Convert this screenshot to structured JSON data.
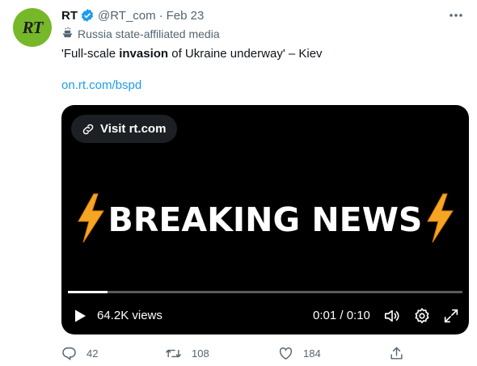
{
  "tweet": {
    "avatar_text": "RT",
    "author_name": "RT",
    "handle": "@RT_com",
    "separator": "·",
    "date": "Feb 23",
    "label": "Russia state-affiliated media",
    "text_before": "'Full-scale ",
    "text_bold": "invasion",
    "text_after": " of Ukraine underway' – Kiev",
    "link": "on.rt.com/bspd"
  },
  "media": {
    "visit_label": "Visit rt.com",
    "headline": "BREAKING NEWS",
    "views": "64.2K views",
    "time": "0:01 / 0:10",
    "progress_fraction": 0.1
  },
  "actions": {
    "replies": "42",
    "retweets": "108",
    "likes": "184"
  },
  "colors": {
    "accent": "#1d9bf0",
    "avatar_bg": "#77b82a",
    "muted": "#536471",
    "media_bg": "#000000",
    "lightning": "#f5a623"
  },
  "icons": [
    "verified-badge-icon",
    "more-icon",
    "state-media-icon",
    "link-icon",
    "lightning-icon",
    "play-icon",
    "volume-icon",
    "settings-icon",
    "fullscreen-icon",
    "reply-icon",
    "retweet-icon",
    "like-icon",
    "share-icon"
  ]
}
